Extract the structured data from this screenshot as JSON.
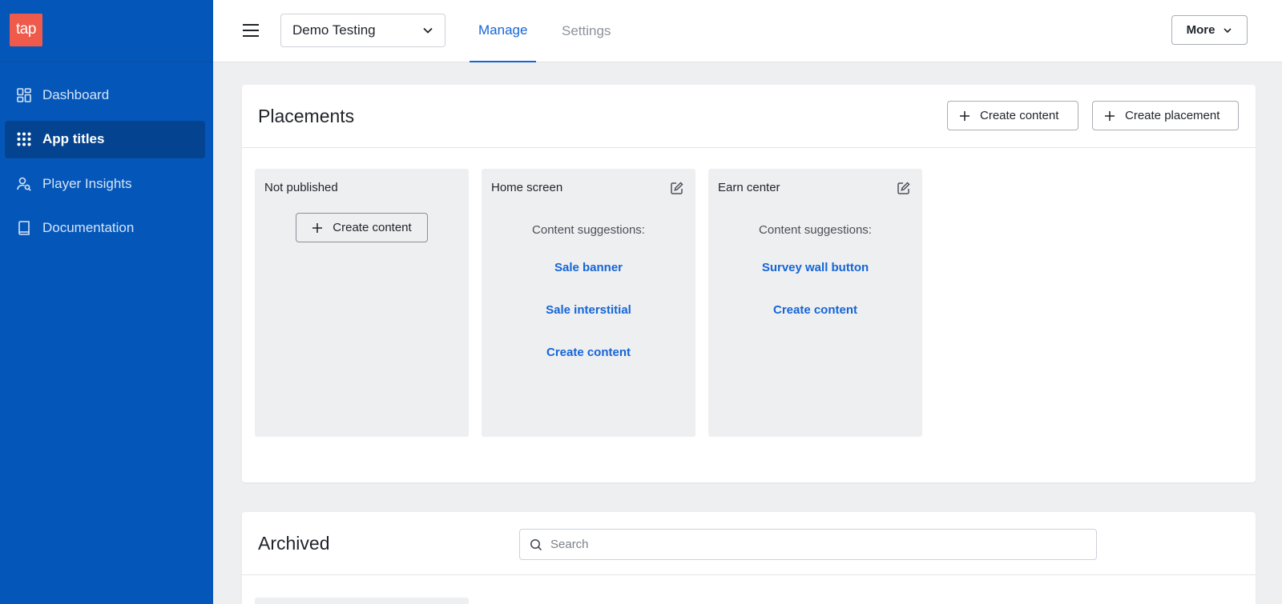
{
  "logo": {
    "text": "tap",
    "color": "#ef5a4a"
  },
  "colors": {
    "sidebar": "#0457b9",
    "accent": "#1565d6"
  },
  "sidebar": {
    "items": [
      {
        "label": "Dashboard",
        "icon": "dashboard-icon",
        "active": false
      },
      {
        "label": "App titles",
        "icon": "grid-dots-icon",
        "active": true
      },
      {
        "label": "Player Insights",
        "icon": "user-search-icon",
        "active": false
      },
      {
        "label": "Documentation",
        "icon": "book-icon",
        "active": false
      }
    ]
  },
  "topbar": {
    "app_select": {
      "value": "Demo Testing"
    },
    "tabs": [
      {
        "label": "Manage",
        "active": true
      },
      {
        "label": "Settings",
        "active": false
      }
    ],
    "more_label": "More"
  },
  "placements": {
    "title": "Placements",
    "create_content_label": "Create content",
    "create_placement_label": "Create placement",
    "columns": [
      {
        "title": "Not published",
        "button_label": "Create content"
      },
      {
        "title": "Home screen",
        "suggestions_label": "Content suggestions:",
        "links": [
          "Sale banner",
          "Sale interstitial",
          "Create content"
        ]
      },
      {
        "title": "Earn center",
        "suggestions_label": "Content suggestions:",
        "links": [
          "Survey wall button",
          "Create content"
        ]
      }
    ]
  },
  "archived": {
    "title": "Archived",
    "search": {
      "placeholder": "Search",
      "value": ""
    }
  }
}
